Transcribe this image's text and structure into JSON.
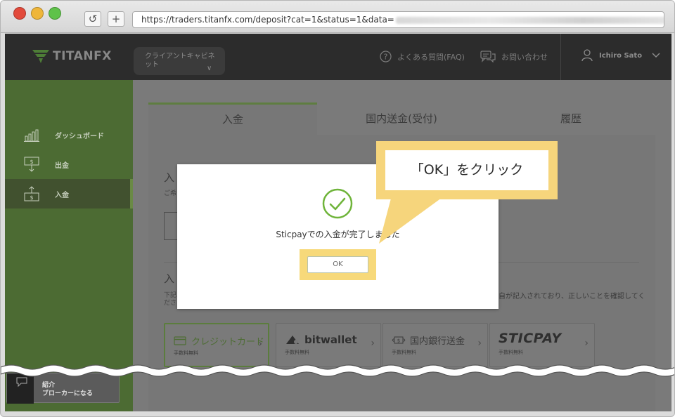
{
  "browser": {
    "url": "https://traders.titanfx.com/deposit?cat=1&status=1&data=",
    "reload_glyph": "↺",
    "add_tab_glyph": "+"
  },
  "header": {
    "logo_text": "TITANFX",
    "cabinet_label": "クライアントキャビネット",
    "faq_label": "よくある質問(FAQ)",
    "contact_label": "お問い合わせ",
    "user_name": "Ichiro Sato"
  },
  "sidebar": {
    "items": [
      {
        "label": "ダッシュボード",
        "icon": "bar-chart-icon"
      },
      {
        "label": "出金",
        "icon": "withdraw-icon"
      },
      {
        "label": "入金",
        "icon": "deposit-icon",
        "active": true
      }
    ],
    "intro_line1": "紹介",
    "intro_line2": "ブローカーになる"
  },
  "tabs": [
    {
      "label": "入金",
      "active": true
    },
    {
      "label": "国内送金(受付)"
    },
    {
      "label": "履歴"
    }
  ],
  "panel": {
    "heading1": "入",
    "small1": "ご希",
    "heading2": "入",
    "note1": "下記",
    "note1_right": "自が記入されており、正しいことを確認してく",
    "note2": "ださ"
  },
  "payment_methods": [
    {
      "name": "クレジットカード",
      "fee": "手数料無料",
      "icon": "credit-card-icon"
    },
    {
      "name": "bitwallet",
      "fee": "手数料無料",
      "icon": "bitwallet-icon"
    },
    {
      "name": "国内銀行送金",
      "fee": "手数料無料",
      "icon": "bank-transfer-icon"
    },
    {
      "name": "STICPAY",
      "fee": "手数料無料",
      "icon": "sticpay-logo"
    }
  ],
  "modal": {
    "message": "Sticpayでの入金が完了しました",
    "ok_label": "OK"
  },
  "callout": {
    "text": "「OK」をクリック"
  },
  "colors": {
    "brand_green": "#5e7d40",
    "highlight_yellow": "#f6d57c",
    "check_green": "#6fb43a"
  }
}
